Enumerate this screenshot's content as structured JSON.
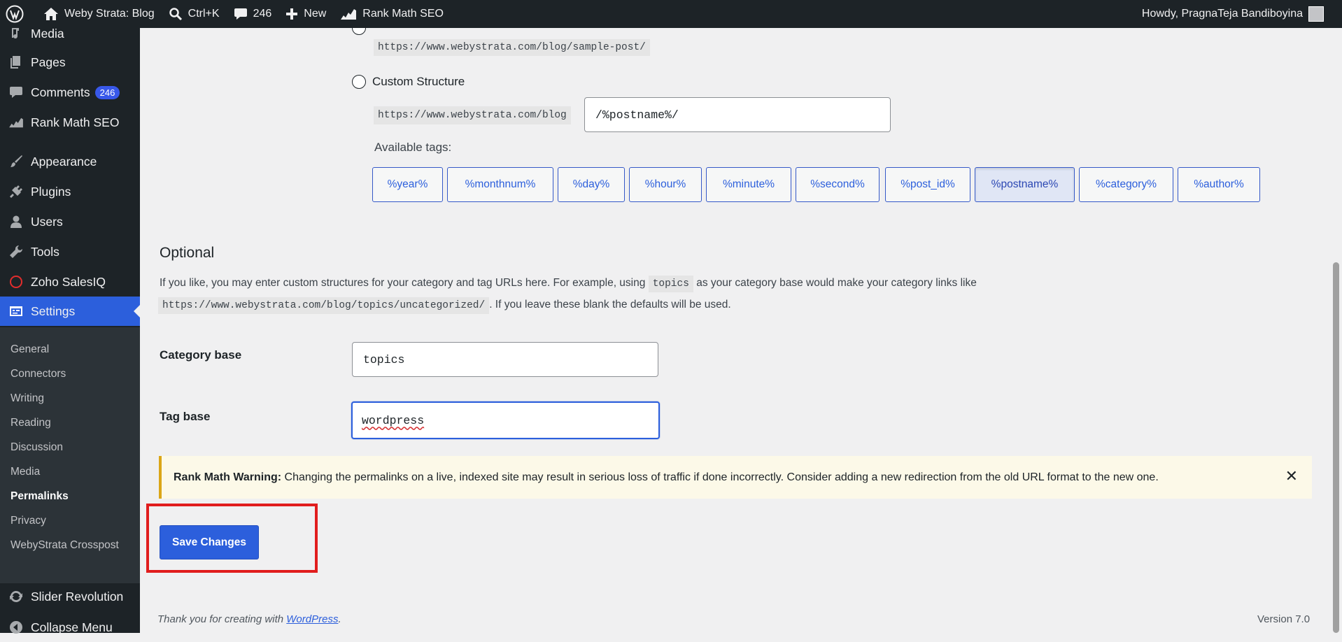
{
  "adminbar": {
    "site": "Weby Strata: Blog",
    "search": "Ctrl+K",
    "comments_count": "246",
    "new_label": "New",
    "rankmath": "Rank Math SEO",
    "howdy": "Howdy, PragnaTeja Bandiboyina"
  },
  "sidebar": {
    "items": [
      {
        "label": "Media",
        "icon": "media-icon"
      },
      {
        "label": "Pages",
        "icon": "pages-icon"
      },
      {
        "label": "Comments",
        "icon": "comments-icon",
        "badge": "246"
      },
      {
        "label": "Rank Math SEO",
        "icon": "rankmath-icon"
      },
      {
        "label": "Appearance",
        "icon": "brush-icon"
      },
      {
        "label": "Plugins",
        "icon": "plug-icon"
      },
      {
        "label": "Users",
        "icon": "user-icon"
      },
      {
        "label": "Tools",
        "icon": "wrench-icon"
      },
      {
        "label": "Zoho SalesIQ",
        "icon": "zoho-icon"
      },
      {
        "label": "Settings",
        "icon": "settings-icon"
      },
      {
        "label": "Slider Revolution",
        "icon": "refresh-icon"
      },
      {
        "label": "Collapse Menu",
        "icon": "collapse-icon"
      }
    ],
    "submenu": [
      "General",
      "Connectors",
      "Writing",
      "Reading",
      "Discussion",
      "Media",
      "Permalinks",
      "Privacy",
      "WebyStrata Crosspost"
    ],
    "current_sub": "Permalinks"
  },
  "main": {
    "sample_url": "https://www.webystrata.com/blog/sample-post/",
    "custom_structure_label": "Custom Structure",
    "custom_prefix": "https://www.webystrata.com/blog",
    "custom_value": "/%postname%/",
    "available_tags_label": "Available tags:",
    "tags": [
      "%year%",
      "%monthnum%",
      "%day%",
      "%hour%",
      "%minute%",
      "%second%",
      "%post_id%",
      "%postname%",
      "%category%",
      "%author%"
    ],
    "pressed_tag": "%postname%",
    "optional_title": "Optional",
    "optional_desc_1": "If you like, you may enter custom structures for your category and tag URLs here. For example, using",
    "optional_code_1": "topics",
    "optional_desc_2": "as your category base would make your category links like",
    "optional_code_2": "https://www.webystrata.com/blog/topics/uncategorized/",
    "optional_desc_3": ". If you leave these blank the defaults will be used.",
    "category_base_label": "Category base",
    "category_base_value": "topics",
    "tag_base_label": "Tag base",
    "tag_base_value": "wordpress",
    "warning_bold": "Rank Math Warning:",
    "warning_text": "Changing the permalinks on a live, indexed site may result in serious loss of traffic if done incorrectly. Consider adding a new redirection from the old URL format to the new one.",
    "save_label": "Save Changes"
  },
  "footer": {
    "thanks_prefix": "Thank you for creating with",
    "thanks_link": "WordPress",
    "thanks_suffix": ".",
    "version": "Version 7.0"
  }
}
